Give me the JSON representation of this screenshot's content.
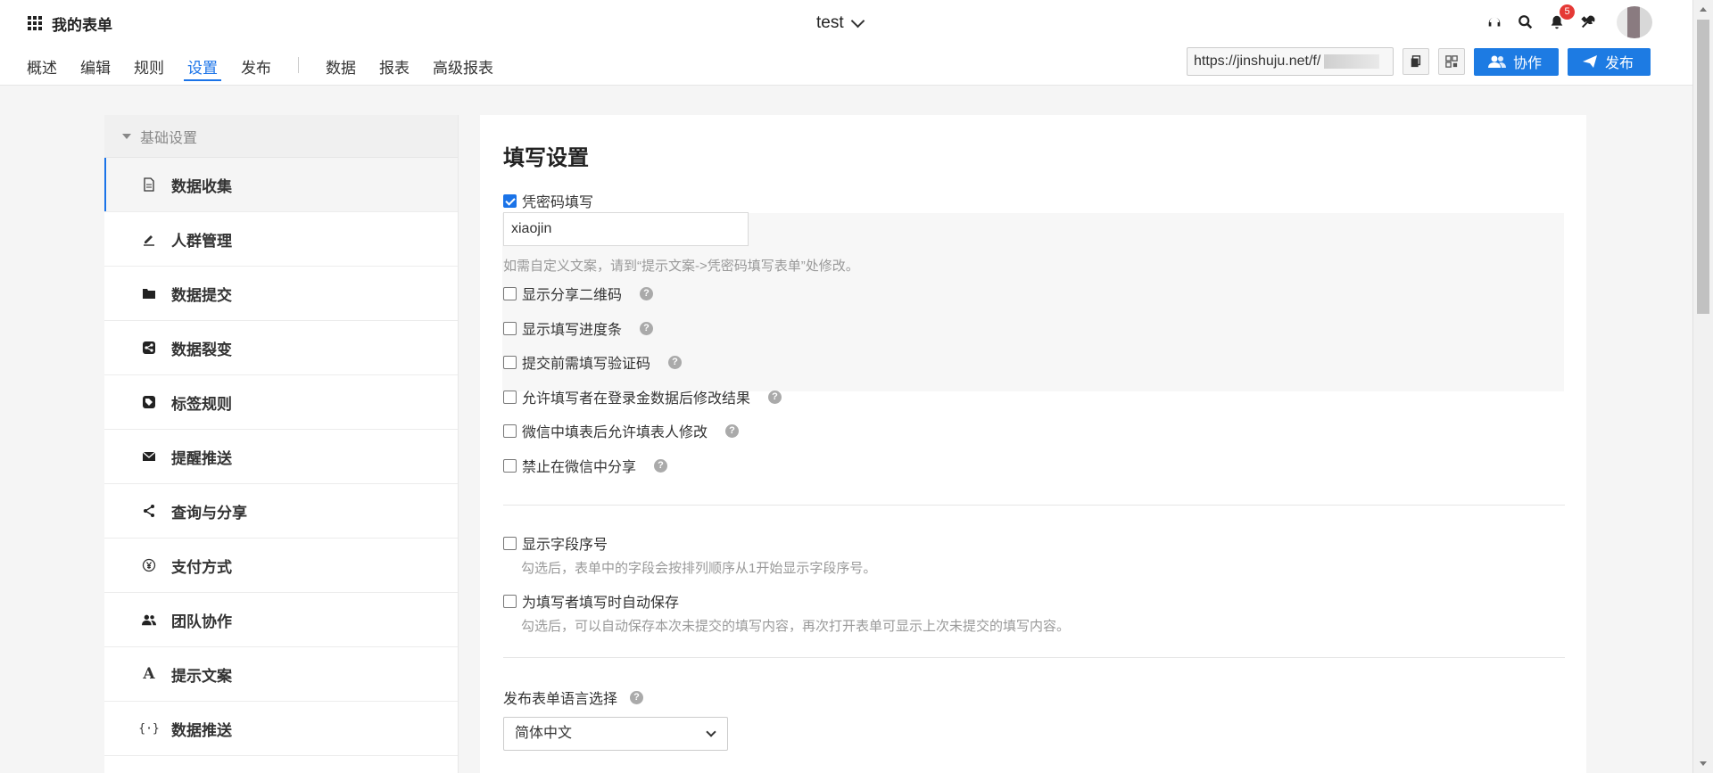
{
  "header": {
    "brand": "我的表单",
    "form_title": "test",
    "notification_count": "5",
    "share_url": "https://jinshuju.net/f/",
    "collab_label": "协作",
    "publish_label": "发布"
  },
  "nav": {
    "items": [
      "概述",
      "编辑",
      "规则",
      "设置",
      "发布"
    ],
    "items2": [
      "数据",
      "报表",
      "高级报表"
    ],
    "active": "设置"
  },
  "sidebar": {
    "section": "基础设置",
    "items": [
      {
        "label": "数据收集",
        "icon": "document-icon"
      },
      {
        "label": "人群管理",
        "icon": "pen-icon"
      },
      {
        "label": "数据提交",
        "icon": "folder-icon"
      },
      {
        "label": "数据裂变",
        "icon": "share-square-icon"
      },
      {
        "label": "标签规则",
        "icon": "tag-icon"
      },
      {
        "label": "提醒推送",
        "icon": "envelope-icon"
      },
      {
        "label": "查询与分享",
        "icon": "share-icon"
      },
      {
        "label": "支付方式",
        "icon": "yen-icon"
      },
      {
        "label": "团队协作",
        "icon": "team-icon"
      },
      {
        "label": "提示文案",
        "icon": "font-icon"
      },
      {
        "label": "数据推送",
        "icon": "braces-icon"
      }
    ]
  },
  "main": {
    "title": "填写设置",
    "password": {
      "label": "凭密码填写",
      "checked": true,
      "value": "xiaojin",
      "hint": "如需自定义文案，请到“提示文案->凭密码填写表单”处修改。"
    },
    "options": [
      "显示分享二维码",
      "显示填写进度条",
      "提交前需填写验证码",
      "允许填写者在登录金数据后修改结果",
      "微信中填表后允许填表人修改",
      "禁止在微信中分享"
    ],
    "field_number": {
      "label": "显示字段序号",
      "hint": "勾选后，表单中的字段会按排列顺序从1开始显示字段序号。"
    },
    "autosave": {
      "label": "为填写者填写时自动保存",
      "hint": "勾选后，可以自动保存本次未提交的填写内容，再次打开表单可显示上次未提交的填写内容。"
    },
    "language": {
      "label": "发布表单语言选择",
      "selected": "简体中文"
    }
  },
  "colors": {
    "accent": "#1a73e8",
    "button_blue": "#1d7be3",
    "badge": "#e53935"
  }
}
